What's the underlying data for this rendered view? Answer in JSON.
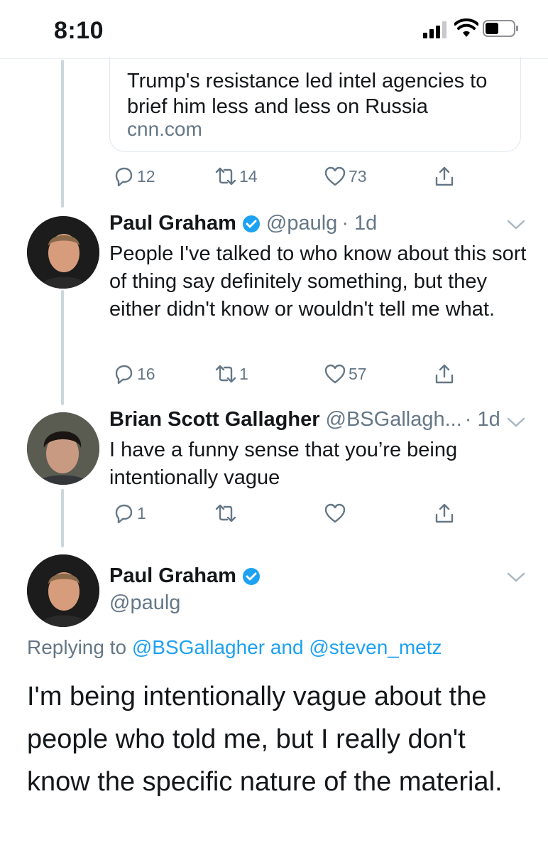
{
  "status_bar": {
    "time": "8:10"
  },
  "link_card": {
    "title": "Trump's resistance led intel agencies to brief him less and less on Russia",
    "domain": "cnn.com"
  },
  "tweet0_actions": {
    "replies": "12",
    "retweets": "14",
    "likes": "73"
  },
  "tweet1": {
    "name": "Paul Graham",
    "handle": "@paulg",
    "time": "· 1d",
    "text": "People I've talked to who know about this sort of thing say definitely something, but they either didn't know or wouldn't tell me what.",
    "replies": "16",
    "retweets": "1",
    "likes": "57"
  },
  "tweet2": {
    "name": "Brian Scott Gallagher",
    "handle": "@BSGallagh...",
    "time": "· 1d",
    "text": "I have a funny sense that you’re being intentionally vague",
    "replies": "1",
    "retweets": "",
    "likes": ""
  },
  "main_tweet": {
    "name": "Paul Graham",
    "handle": "@paulg",
    "replying_prefix": "Replying to ",
    "reply_to_1": "@BSGallagher",
    "reply_and": " and ",
    "reply_to_2": "@steven_metz",
    "text": "I'm being intentionally vague about the people who told me, but I really don't know the specific nature of the material."
  },
  "colors": {
    "accent": "#1da1f2",
    "muted": "#657786",
    "line": "#ccd6dd"
  },
  "icons": [
    "reply-icon",
    "retweet-icon",
    "like-icon",
    "share-icon",
    "verified-icon",
    "chevron-down-icon"
  ]
}
